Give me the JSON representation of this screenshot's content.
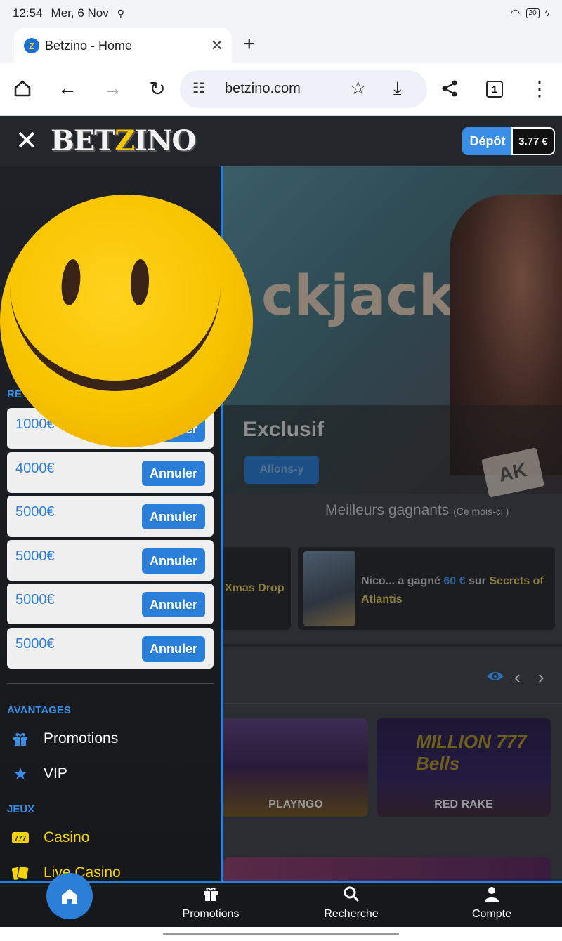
{
  "status": {
    "time": "12:54",
    "date": "Mer, 6 Nov",
    "battery": "20"
  },
  "browser": {
    "tab_title": "Betzino - Home",
    "url": "betzino.com",
    "tab_count": "1"
  },
  "site": {
    "logo_prefix": "BET",
    "logo_z": "Z",
    "logo_suffix": "INO",
    "deposit_label": "Dépôt",
    "balance": "3.77 €"
  },
  "hero": {
    "word": "ckjack",
    "title": "Exclusif",
    "button": "Allons-y",
    "card": "AK"
  },
  "winners": {
    "title": "Meilleurs gagnants",
    "period": "(Ce mois-ci )",
    "card1_game": "Xmas Drop",
    "card2_user": "Nico... a gagné",
    "card2_amount": "60 €",
    "card2_on": "sur",
    "card2_game": "Secrets of Atlantis"
  },
  "games": [
    {
      "provider": "PLAYNGO"
    },
    {
      "provider": "RED RAKE",
      "title": "MILLION 777 Bells"
    }
  ],
  "drawer": {
    "withdrawals_label": "RETRAITS",
    "bets": [
      {
        "amount": "1000€",
        "action": "Annuler"
      },
      {
        "amount": "4000€",
        "action": "Annuler"
      },
      {
        "amount": "5000€",
        "action": "Annuler"
      },
      {
        "amount": "5000€",
        "action": "Annuler"
      },
      {
        "amount": "5000€",
        "action": "Annuler"
      },
      {
        "amount": "5000€",
        "action": "Annuler"
      }
    ],
    "advantages_label": "AVANTAGES",
    "promotions": "Promotions",
    "vip": "VIP",
    "games_label": "JEUX",
    "casino": "Casino",
    "live_casino": "Live Casino"
  },
  "bottom_nav": {
    "promotions": "Promotions",
    "search": "Recherche",
    "account": "Compte"
  },
  "colors": {
    "accent": "#2c7fd8",
    "gold": "#f5d400",
    "smiley": "#f8c400"
  }
}
